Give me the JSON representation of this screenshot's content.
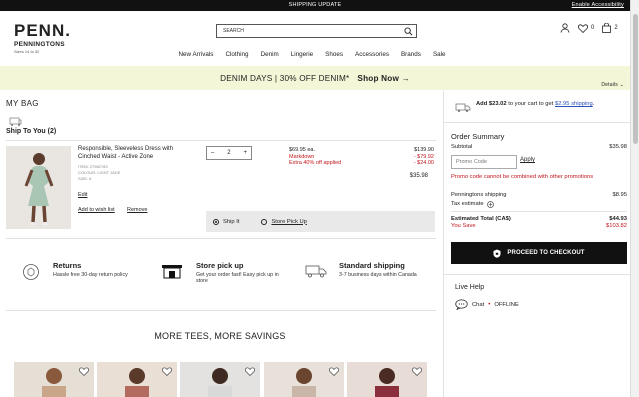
{
  "top_bar": {
    "message": "SHIPPING UPDATE",
    "accessibility_link": "Enable Accessibility"
  },
  "logo": {
    "brand": "PENN.",
    "sub": "PENNINGTONS",
    "tag": "Sizes 14 to 32"
  },
  "search": {
    "placeholder": "SEARCH"
  },
  "header_icons": {
    "wishlist_count": "0",
    "cart_count": "2"
  },
  "nav": [
    "New Arrivals",
    "Clothing",
    "Denim",
    "Lingerie",
    "Shoes",
    "Accessories",
    "Brands",
    "Sale"
  ],
  "promo_banner": {
    "text": "DENIM DAYS | 30% OFF DENIM*",
    "cta": "Shop Now →",
    "details": "Details"
  },
  "bag": {
    "title": "MY BAG",
    "ship_to": "Ship To You (2)"
  },
  "product": {
    "name": "Responsible, Sleeveless Dress with Cinched Waist - Active Zone",
    "item": "ITEM: 27982783",
    "colour": "COLOUR: LIGHT JADE",
    "size": "SIZE: 6",
    "edit": "Edit",
    "add_wishlist": "Add to wish list",
    "remove": "Remove",
    "qty": "2",
    "price_each": "$69.95 ea.",
    "markdown": "Markdown",
    "extra": "Extra 40% off applied",
    "line_original": "$139.90",
    "line_markdown": "- $79.92",
    "line_extra": "- $24.00",
    "line_total": "$35.98",
    "ship_it": "Ship It",
    "store_pickup": "Store Pick Up"
  },
  "benefits": [
    {
      "title": "Returns",
      "text": "Hassle free 30-day return policy"
    },
    {
      "title": "Store pick up",
      "text": "Get your order fast! Easy pick up in store"
    },
    {
      "title": "Standard shipping",
      "text": "3-7 business days within Canada"
    }
  ],
  "more_section": {
    "title": "MORE TEES, MORE SAVINGS"
  },
  "summary": {
    "free_ship_prefix": "Add $23.02",
    "free_ship_middle": "to your cart to get",
    "free_ship_link": "$2.95 shipping",
    "free_ship_suffix": ".",
    "title": "Order Summary",
    "subtotal_label": "Subtotal",
    "subtotal": "$35.98",
    "promo_placeholder": "Promo Code",
    "apply": "Apply",
    "promo_error": "Promo code cannot be combined with other promotions",
    "shipping_label": "Penningtons shipping",
    "shipping": "$8.95",
    "tax_label": "Tax estimate",
    "total_label": "Estimated Total (CA$)",
    "total": "$44.93",
    "save_label": "You Save",
    "save": "$103.82",
    "checkout": "PROCEED TO CHECKOUT",
    "live_help": "Live Help",
    "chat": "Chat",
    "chat_status": "OFFLINE"
  },
  "colors": {
    "accent_red": "#c0161c",
    "banner_bg": "#f4f6d8",
    "dark": "#111111"
  }
}
